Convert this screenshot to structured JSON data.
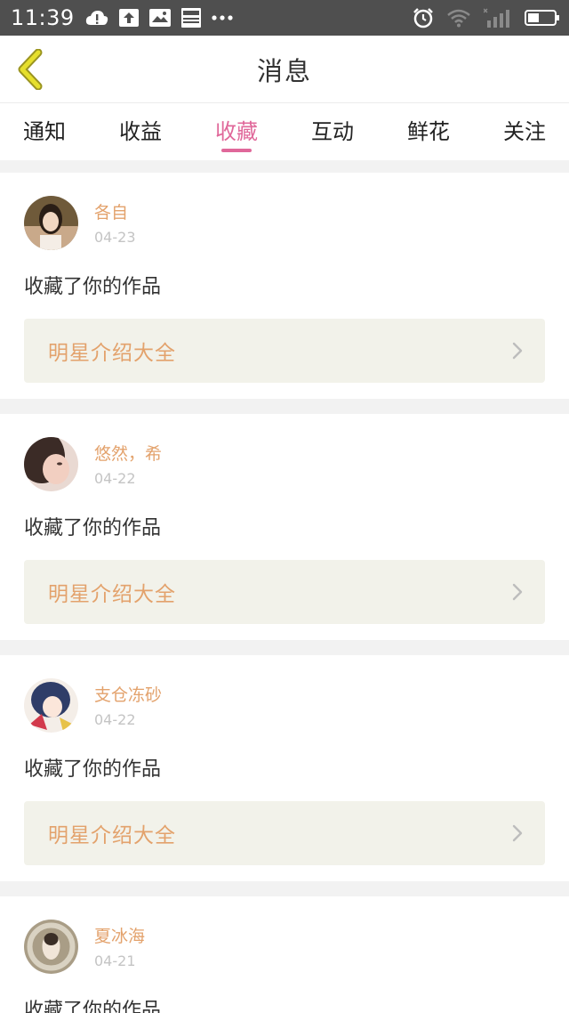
{
  "status_bar": {
    "time": "11:39",
    "icons": [
      "cloud-alert-icon",
      "upload-icon",
      "image-icon",
      "news-icon",
      "more-dots-icon",
      "alarm-icon",
      "wifi-icon",
      "signal-icon",
      "battery-icon"
    ]
  },
  "header": {
    "title": "消息",
    "back_icon": "chevron-left-icon"
  },
  "tabs": [
    {
      "label": "通知",
      "active": false
    },
    {
      "label": "收益",
      "active": false
    },
    {
      "label": "收藏",
      "active": true
    },
    {
      "label": "互动",
      "active": false
    },
    {
      "label": "鲜花",
      "active": false
    },
    {
      "label": "关注",
      "active": false
    }
  ],
  "colors": {
    "accent": "#e0689a",
    "username": "#e3a26c",
    "date": "#c4c4c4",
    "work_bg": "#f2f2ea",
    "back_icon": "#d8d22a"
  },
  "messages": [
    {
      "user": "各自",
      "date": "04-23",
      "action": "收藏了你的作品",
      "work": "明星介绍大全"
    },
    {
      "user": "悠然，希",
      "date": "04-22",
      "action": "收藏了你的作品",
      "work": "明星介绍大全"
    },
    {
      "user": "支仓冻砂",
      "date": "04-22",
      "action": "收藏了你的作品",
      "work": "明星介绍大全"
    },
    {
      "user": "夏冰海",
      "date": "04-21",
      "action": "收藏了你的作品",
      "work": ""
    }
  ]
}
